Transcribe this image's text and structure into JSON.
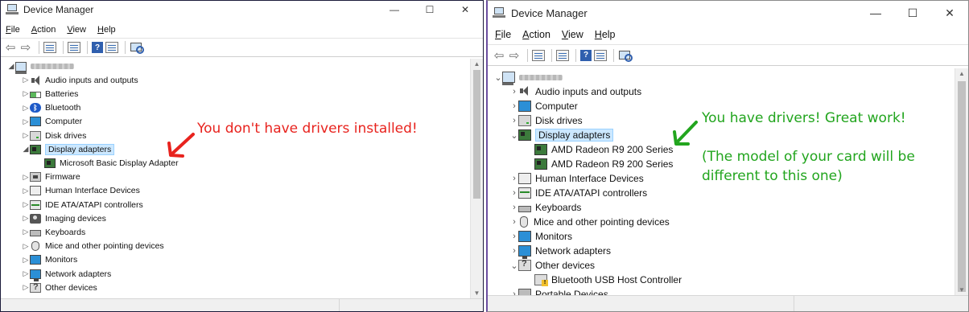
{
  "left_window": {
    "title": "Device Manager",
    "window_controls": {
      "minimize": "—",
      "maximize": "☐",
      "close": "✕"
    },
    "menu": [
      {
        "label": "File",
        "key": "F",
        "rest": "ile"
      },
      {
        "label": "Action",
        "key": "A",
        "rest": "ction"
      },
      {
        "label": "View",
        "key": "V",
        "rest": "iew"
      },
      {
        "label": "Help",
        "key": "H",
        "rest": "elp"
      }
    ],
    "tree": [
      {
        "label": "",
        "level": 0,
        "expander": "◢",
        "icon": "computer-icon",
        "host": true
      },
      {
        "label": "Audio inputs and outputs",
        "level": 1,
        "expander": "▷",
        "icon": "speaker-icon"
      },
      {
        "label": "Batteries",
        "level": 1,
        "expander": "▷",
        "icon": "battery-icon"
      },
      {
        "label": "Bluetooth",
        "level": 1,
        "expander": "▷",
        "icon": "bluetooth-icon"
      },
      {
        "label": "Computer",
        "level": 1,
        "expander": "▷",
        "icon": "monitor-icon"
      },
      {
        "label": "Disk drives",
        "level": 1,
        "expander": "▷",
        "icon": "disk-icon"
      },
      {
        "label": "Display adapters",
        "level": 1,
        "expander": "◢",
        "icon": "display-adapter-icon",
        "selected": true
      },
      {
        "label": "Microsoft Basic Display Adapter",
        "level": 2,
        "expander": "",
        "icon": "display-adapter-icon"
      },
      {
        "label": "Firmware",
        "level": 1,
        "expander": "▷",
        "icon": "chip-icon"
      },
      {
        "label": "Human Interface Devices",
        "level": 1,
        "expander": "▷",
        "icon": "hid-icon"
      },
      {
        "label": "IDE ATA/ATAPI controllers",
        "level": 1,
        "expander": "▷",
        "icon": "ide-icon"
      },
      {
        "label": "Imaging devices",
        "level": 1,
        "expander": "▷",
        "icon": "camera-icon"
      },
      {
        "label": "Keyboards",
        "level": 1,
        "expander": "▷",
        "icon": "keyboard-icon"
      },
      {
        "label": "Mice and other pointing devices",
        "level": 1,
        "expander": "▷",
        "icon": "mouse-icon"
      },
      {
        "label": "Monitors",
        "level": 1,
        "expander": "▷",
        "icon": "monitor-icon"
      },
      {
        "label": "Network adapters",
        "level": 1,
        "expander": "▷",
        "icon": "network-icon"
      },
      {
        "label": "Other devices",
        "level": 1,
        "expander": "▷",
        "icon": "other-devices-icon"
      }
    ],
    "annotation": "You don't have drivers installed!"
  },
  "right_window": {
    "title": "Device Manager",
    "window_controls": {
      "minimize": "—",
      "maximize": "☐",
      "close": "✕"
    },
    "menu": [
      {
        "label": "File",
        "key": "F",
        "rest": "ile"
      },
      {
        "label": "Action",
        "key": "A",
        "rest": "ction"
      },
      {
        "label": "View",
        "key": "V",
        "rest": "iew"
      },
      {
        "label": "Help",
        "key": "H",
        "rest": "elp"
      }
    ],
    "tree": [
      {
        "label": "",
        "level": 0,
        "expander": "⌄",
        "icon": "computer-icon",
        "host": true
      },
      {
        "label": "Audio inputs and outputs",
        "level": 1,
        "expander": "›",
        "icon": "speaker-icon"
      },
      {
        "label": "Computer",
        "level": 1,
        "expander": "›",
        "icon": "monitor-icon"
      },
      {
        "label": "Disk drives",
        "level": 1,
        "expander": "›",
        "icon": "disk-icon"
      },
      {
        "label": "Display adapters",
        "level": 1,
        "expander": "⌄",
        "icon": "display-adapter-icon",
        "selected": true
      },
      {
        "label": "AMD Radeon R9 200 Series",
        "level": 2,
        "expander": "",
        "icon": "display-adapter-icon"
      },
      {
        "label": "AMD Radeon R9 200 Series",
        "level": 2,
        "expander": "",
        "icon": "display-adapter-icon"
      },
      {
        "label": "Human Interface Devices",
        "level": 1,
        "expander": "›",
        "icon": "hid-icon"
      },
      {
        "label": "IDE ATA/ATAPI controllers",
        "level": 1,
        "expander": "›",
        "icon": "ide-icon"
      },
      {
        "label": "Keyboards",
        "level": 1,
        "expander": "›",
        "icon": "keyboard-icon"
      },
      {
        "label": "Mice and other pointing devices",
        "level": 1,
        "expander": "›",
        "icon": "mouse-icon"
      },
      {
        "label": "Monitors",
        "level": 1,
        "expander": "›",
        "icon": "monitor-icon"
      },
      {
        "label": "Network adapters",
        "level": 1,
        "expander": "›",
        "icon": "network-icon"
      },
      {
        "label": "Other devices",
        "level": 1,
        "expander": "⌄",
        "icon": "other-devices-icon"
      },
      {
        "label": "Bluetooth USB Host Controller",
        "level": 2,
        "expander": "",
        "icon": "warning-device-icon"
      },
      {
        "label": "Portable Devices",
        "level": 1,
        "expander": "›",
        "icon": "portable-device-icon"
      }
    ],
    "annotation_line1": "You have drivers! Great work!",
    "annotation_line2": "(The model of your card will be different to this one)"
  },
  "colors": {
    "annotation_red": "#e8231e",
    "annotation_green": "#22a51e",
    "selection_fill": "#cce8ff",
    "selection_border": "#99d1ff"
  }
}
